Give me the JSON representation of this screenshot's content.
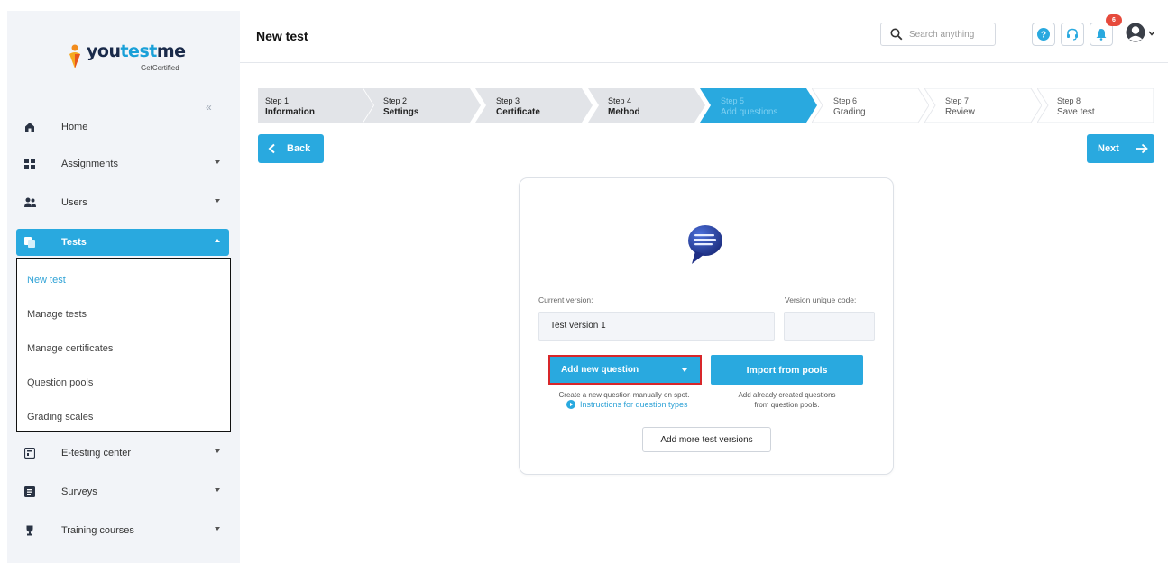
{
  "app": {
    "logo_text_main": "you",
    "logo_text_accent": "test",
    "logo_text_end": "me",
    "logo_sub": "GetCertified",
    "brand_color": "#29a9df"
  },
  "sidebar": {
    "items": [
      {
        "label": "Home",
        "icon": "home-icon"
      },
      {
        "label": "Assignments",
        "icon": "assignments-icon"
      },
      {
        "label": "Users",
        "icon": "users-icon"
      },
      {
        "label": "Tests",
        "icon": "tests-icon"
      },
      {
        "label": "E-testing center",
        "icon": "e-testing-icon"
      },
      {
        "label": "Surveys",
        "icon": "surveys-icon"
      },
      {
        "label": "Training courses",
        "icon": "trophy-icon"
      }
    ],
    "submenu": [
      "New test",
      "Manage tests",
      "Manage certificates",
      "Question pools",
      "Grading scales"
    ]
  },
  "header": {
    "title": "New test",
    "search_placeholder": "Search anything",
    "notification_count": "6"
  },
  "steps": [
    {
      "num": "Step 1",
      "name": "Information"
    },
    {
      "num": "Step 2",
      "name": "Settings"
    },
    {
      "num": "Step 3",
      "name": "Certificate"
    },
    {
      "num": "Step 4",
      "name": "Method"
    },
    {
      "num": "Step 5",
      "name": "Add questions"
    },
    {
      "num": "Step 6",
      "name": "Grading"
    },
    {
      "num": "Step 7",
      "name": "Review"
    },
    {
      "num": "Step 8",
      "name": "Save test"
    }
  ],
  "nav": {
    "back_label": "Back",
    "next_label": "Next"
  },
  "card": {
    "current_version_label": "Current version:",
    "unique_code_label": "Version unique code:",
    "current_version_value": "Test version 1",
    "unique_code_value": "",
    "add_question_label": "Add new question",
    "import_label": "Import from pools",
    "add_hint": "Create a new question manually on spot.",
    "instructions_link": "Instructions for question types",
    "import_hint_1": "Add already created questions",
    "import_hint_2": "from question pools.",
    "more_versions_label": "Add more test versions"
  }
}
